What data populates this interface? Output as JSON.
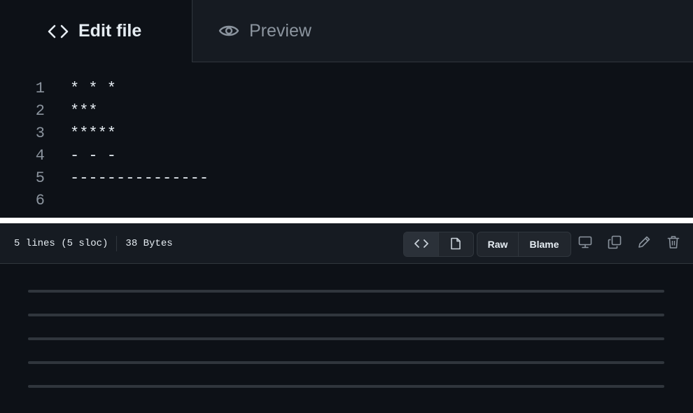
{
  "editor": {
    "tabs": {
      "edit_label": "Edit file",
      "preview_label": "Preview"
    },
    "lines": [
      {
        "num": "1",
        "text": "* * *"
      },
      {
        "num": "2",
        "text": "***"
      },
      {
        "num": "3",
        "text": "*****"
      },
      {
        "num": "4",
        "text": "- - -"
      },
      {
        "num": "5",
        "text": "---------------"
      },
      {
        "num": "6",
        "text": ""
      }
    ]
  },
  "file_view": {
    "lines_info": "5 lines (5 sloc)",
    "size": "38 Bytes",
    "raw_label": "Raw",
    "blame_label": "Blame",
    "placeholder_rows": 5
  },
  "colors": {
    "background": "#0d1117",
    "header": "#161b22",
    "border": "#30363d",
    "text": "#e6edf3",
    "muted": "#8b949e"
  }
}
